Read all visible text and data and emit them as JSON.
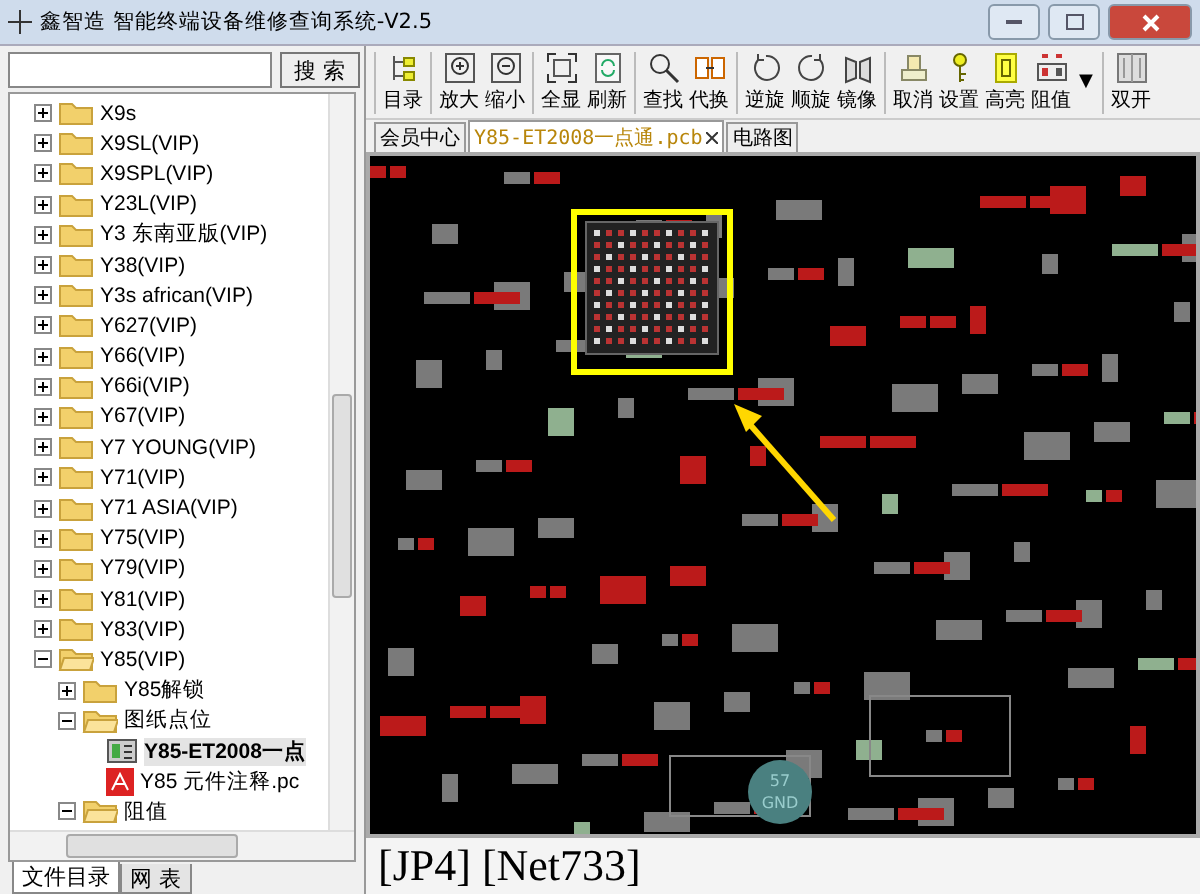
{
  "window": {
    "title": "鑫智造 智能终端设备维修查询系统-V2.5"
  },
  "search": {
    "button": "搜 索"
  },
  "tree": [
    {
      "label": "X9s",
      "kind": "folder",
      "expanded": false
    },
    {
      "label": "X9SL(VIP)",
      "kind": "folder",
      "expanded": false
    },
    {
      "label": "X9SPL(VIP)",
      "kind": "folder",
      "expanded": false
    },
    {
      "label": "Y23L(VIP)",
      "kind": "folder",
      "expanded": false
    },
    {
      "label": "Y3 东南亚版(VIP)",
      "kind": "folder",
      "expanded": false
    },
    {
      "label": "Y38(VIP)",
      "kind": "folder",
      "expanded": false
    },
    {
      "label": "Y3s african(VIP)",
      "kind": "folder",
      "expanded": false
    },
    {
      "label": "Y627(VIP)",
      "kind": "folder",
      "expanded": false
    },
    {
      "label": "Y66(VIP)",
      "kind": "folder",
      "expanded": false
    },
    {
      "label": "Y66i(VIP)",
      "kind": "folder",
      "expanded": false
    },
    {
      "label": "Y67(VIP)",
      "kind": "folder",
      "expanded": false
    },
    {
      "label": "Y7 YOUNG(VIP)",
      "kind": "folder",
      "expanded": false
    },
    {
      "label": "Y71(VIP)",
      "kind": "folder",
      "expanded": false
    },
    {
      "label": "Y71 ASIA(VIP)",
      "kind": "folder",
      "expanded": false
    },
    {
      "label": "Y75(VIP)",
      "kind": "folder",
      "expanded": false
    },
    {
      "label": "Y79(VIP)",
      "kind": "folder",
      "expanded": false
    },
    {
      "label": "Y81(VIP)",
      "kind": "folder",
      "expanded": false
    },
    {
      "label": "Y83(VIP)",
      "kind": "folder",
      "expanded": false
    },
    {
      "label": "Y85(VIP)",
      "kind": "folder",
      "expanded": true,
      "children": [
        {
          "label": "Y85解锁",
          "kind": "folder",
          "expanded": false
        },
        {
          "label": "图纸点位",
          "kind": "folder",
          "expanded": true,
          "children": [
            {
              "label": "Y85-ET2008一点",
              "kind": "pcb",
              "selected": true
            },
            {
              "label": "Y85 元件注释.pc",
              "kind": "pdf",
              "selected": false
            }
          ]
        },
        {
          "label": "阻值",
          "kind": "folder",
          "expanded": true
        }
      ]
    }
  ],
  "left_tabs": [
    {
      "label": "文件目录",
      "selected": true
    },
    {
      "label": "网 表",
      "selected": false
    }
  ],
  "toolbar": [
    [
      {
        "label": "目录",
        "kind": "button"
      }
    ],
    [
      {
        "label": "放大",
        "kind": "button"
      },
      {
        "label": "缩小",
        "kind": "button"
      }
    ],
    [
      {
        "label": "全显",
        "kind": "button"
      },
      {
        "label": "刷新",
        "kind": "button"
      }
    ],
    [
      {
        "label": "查找",
        "kind": "button"
      },
      {
        "label": "代换",
        "kind": "button"
      }
    ],
    [
      {
        "label": "逆旋",
        "kind": "button"
      },
      {
        "label": "顺旋",
        "kind": "button"
      },
      {
        "label": "镜像",
        "kind": "button"
      }
    ],
    [
      {
        "label": "取消",
        "kind": "button"
      },
      {
        "label": "设置",
        "kind": "button"
      },
      {
        "label": "高亮",
        "kind": "button"
      },
      {
        "label": "阻值",
        "kind": "button"
      },
      {
        "label": "▼",
        "kind": "dropdown"
      }
    ],
    [
      {
        "label": "双开",
        "kind": "button"
      }
    ]
  ],
  "doc_tabs": [
    {
      "label": "会员中心",
      "selected": false,
      "closable": false
    },
    {
      "label": "Y85-ET2008一点通.pcb",
      "selected": true,
      "closable": true
    },
    {
      "label": "电路图",
      "selected": false,
      "closable": false
    }
  ],
  "pad_label": [
    "57",
    "GND"
  ],
  "status": "[JP4] [Net733]"
}
